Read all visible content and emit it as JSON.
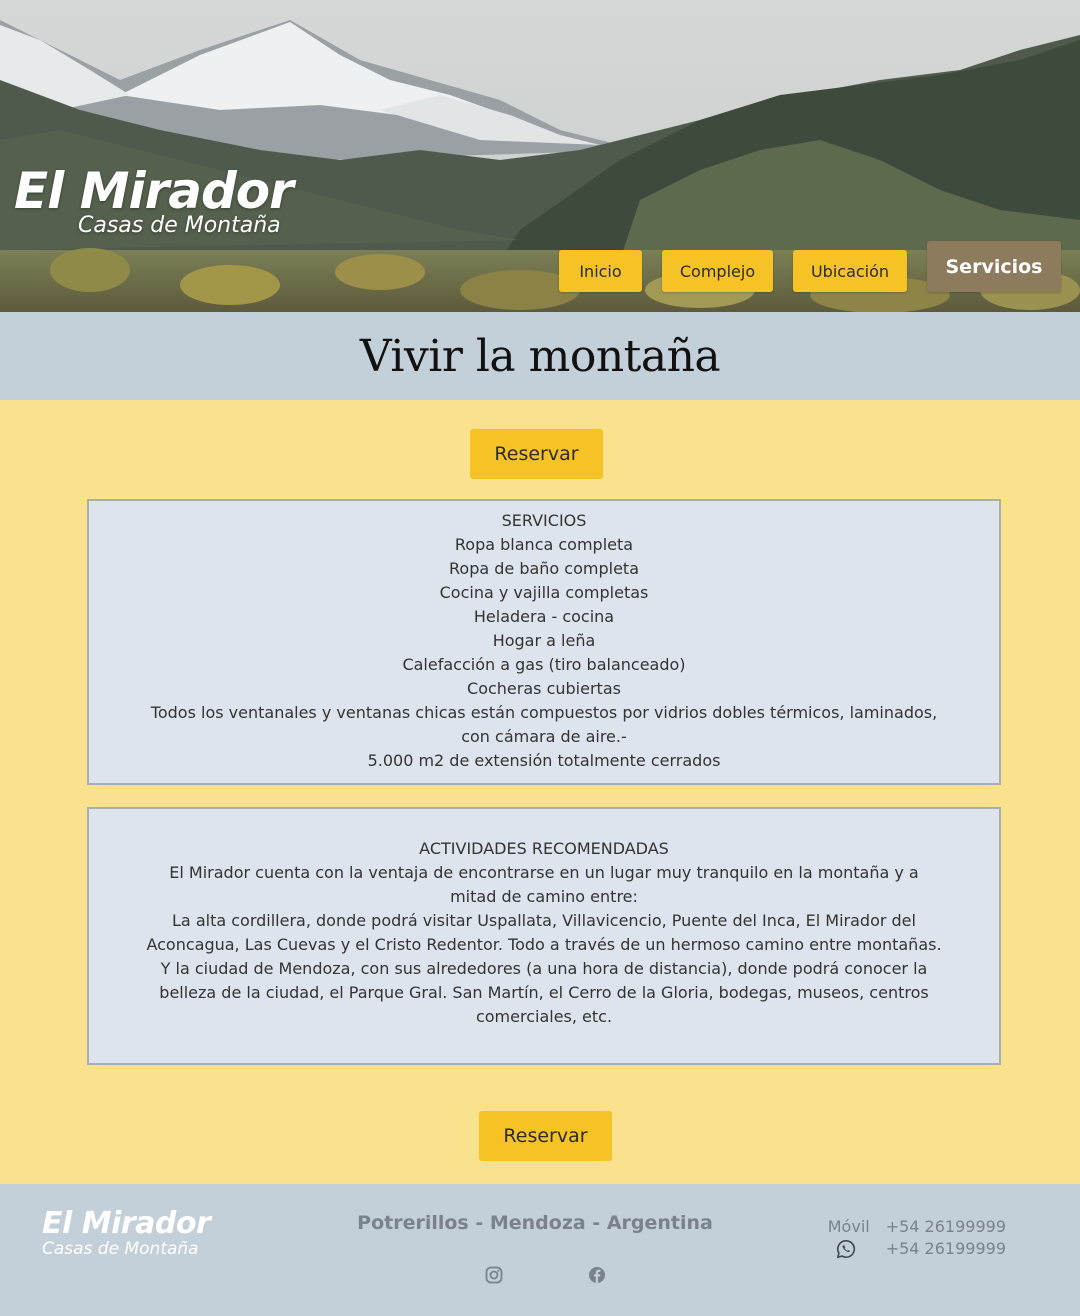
{
  "brand": {
    "name": "El Mirador",
    "tagline": "Casas de Montaña"
  },
  "nav": {
    "items": [
      {
        "label": "Inicio",
        "active": false
      },
      {
        "label": "Complejo",
        "active": false
      },
      {
        "label": "Ubicación",
        "active": false
      },
      {
        "label": "Servicios",
        "active": true
      }
    ]
  },
  "page_title": "Vivir la montaña",
  "reserve_label": "Reservar",
  "services": {
    "title": "SERVICIOS",
    "items": [
      "Ropa blanca completa",
      "Ropa de baño completa",
      "Cocina y vajilla completas",
      "Heladera - cocina",
      "Hogar a leña",
      "Calefacción a gas (tiro balanceado)",
      "Cocheras cubiertas",
      "Todos los ventanales y ventanas chicas están compuestos por vidrios dobles térmicos, laminados, con cámara de aire.-",
      "5.000 m2 de extensión totalmente cerrados"
    ]
  },
  "activities": {
    "title": "ACTIVIDADES RECOMENDADAS",
    "paragraphs": [
      "El Mirador cuenta con la ventaja de encontrarse en un lugar muy tranquilo en la montaña y a mitad de camino entre:",
      "La alta cordillera, donde podrá visitar Uspallata, Villavicencio, Puente del Inca, El Mirador del Aconcagua, Las Cuevas y el Cristo Redentor. Todo a través de un hermoso camino entre montañas.",
      "Y la ciudad de Mendoza, con sus alrededores (a una hora de distancia), donde podrá conocer la belleza de la ciudad, el Parque Gral. San Martín, el Cerro de la Gloria, bodegas, museos, centros comerciales, etc."
    ]
  },
  "footer": {
    "brand_name": "El Mirador",
    "brand_tagline": "Casas de Montaña",
    "location": "Potrerillos - Mendoza - Argentina",
    "mobile_label": "Móvil",
    "mobile_number": "+54 26199999",
    "whatsapp_number": "+54 26199999",
    "social": [
      "instagram-icon",
      "facebook-icon"
    ]
  },
  "colors": {
    "accent": "#f6c327",
    "active_nav": "#8d7b5e",
    "band": "#c3cfd9",
    "page_bg": "#f9e18e",
    "box_bg": "#dee4ed"
  }
}
